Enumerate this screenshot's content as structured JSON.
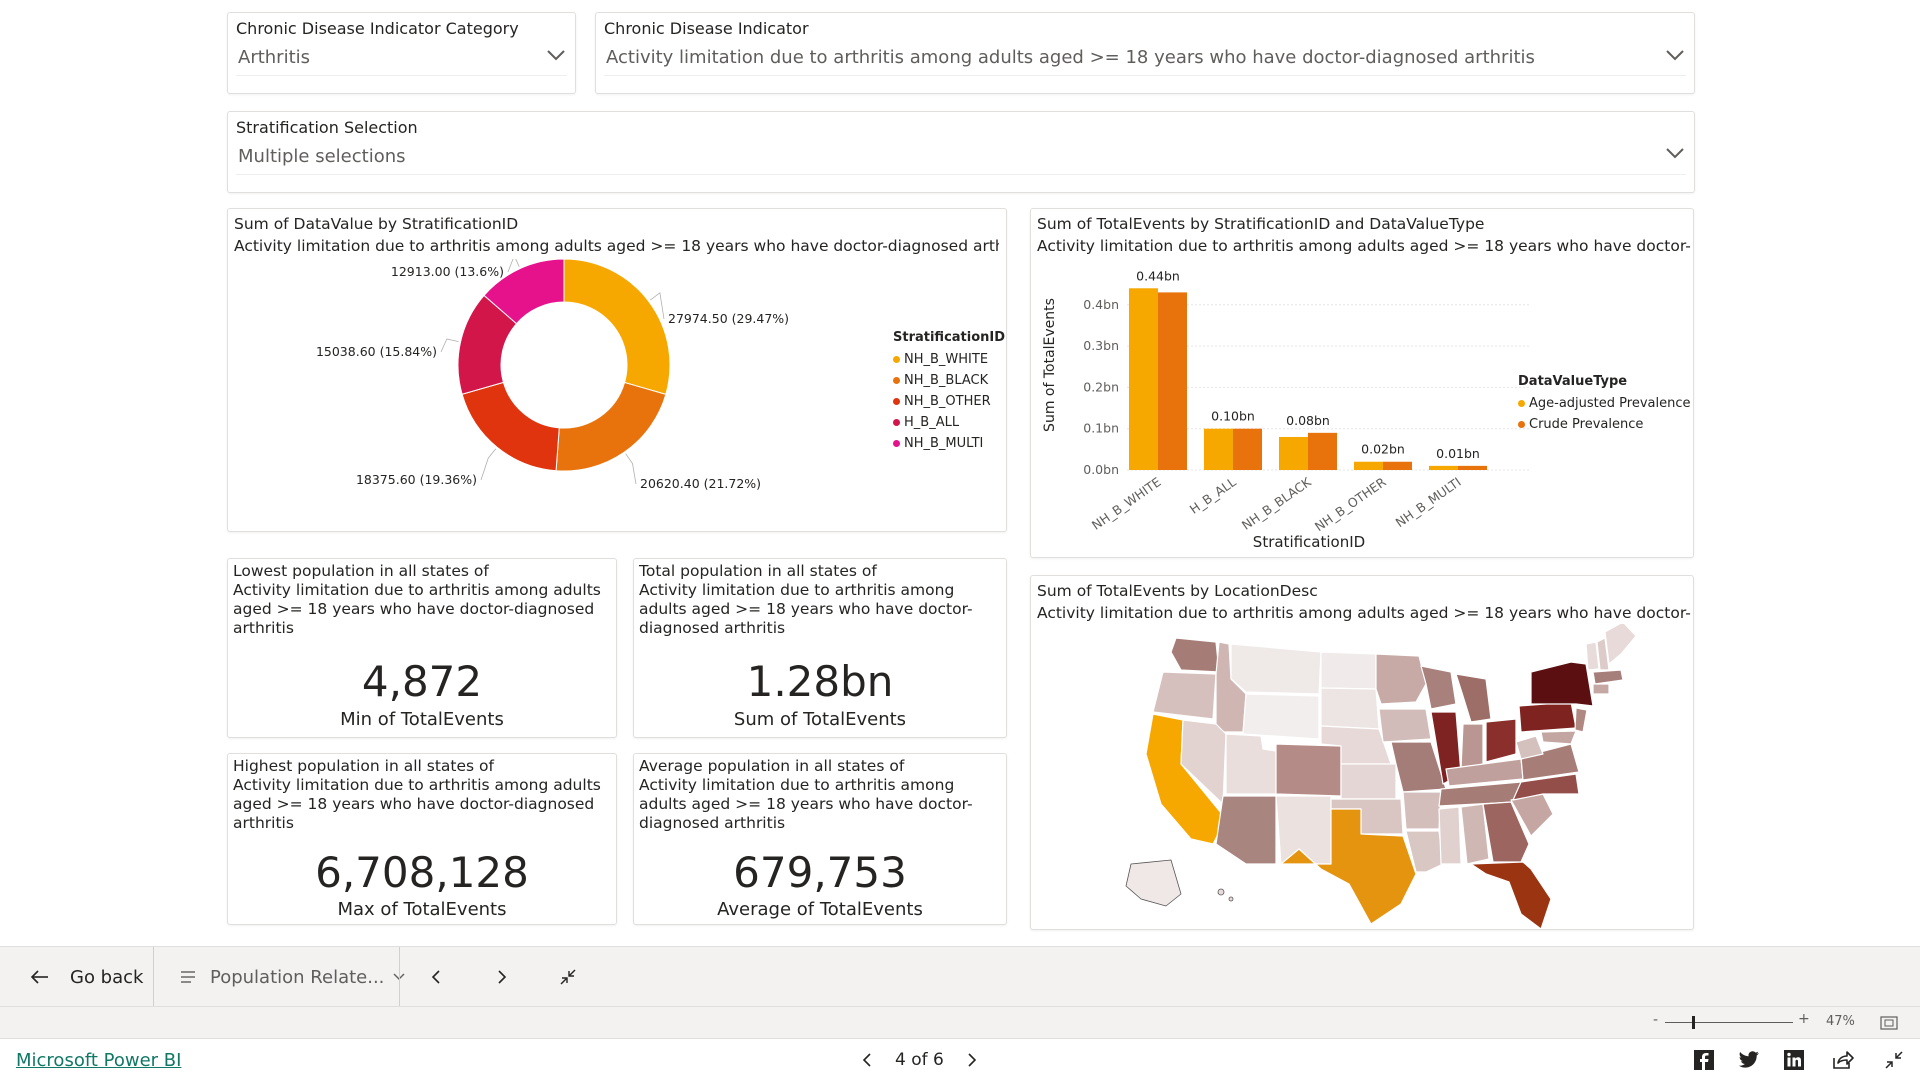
{
  "slicers": {
    "category": {
      "title": "Chronic Disease Indicator Category",
      "value": "Arthritis"
    },
    "indicator": {
      "title": "Chronic Disease Indicator",
      "value": "Activity limitation due to arthritis among adults aged >= 18 years who have doctor-diagnosed arthritis"
    },
    "stratification": {
      "title": "Stratification Selection",
      "value": "Multiple selections"
    }
  },
  "donut": {
    "title": "Sum of DataValue by StratificationID",
    "subtitle": "Activity limitation due to arthritis among adults aged >= 18 years who have doctor-diagnosed arthritis",
    "legend_title": "StratificationID",
    "labels": [
      "27974.50 (29.47%)",
      "20620.40 (21.72%)",
      "18375.60 (19.36%)",
      "15038.60 (15.84%)",
      "12913.00 (13.6%)"
    ]
  },
  "bar": {
    "title": "Sum of TotalEvents by StratificationID and DataValueType",
    "subtitle": "Activity limitation due to arthritis among adults aged >= 18 years who have doctor-dia...",
    "legend_title": "DataValueType",
    "ytick_labels": [
      "0.0bn",
      "0.1bn",
      "0.2bn",
      "0.3bn",
      "0.4bn"
    ],
    "data_labels": [
      "0.44bn",
      "0.10bn",
      "0.08bn",
      "0.02bn",
      "0.01bn"
    ]
  },
  "chart_data": [
    {
      "type": "pie",
      "title": "Sum of DataValue by StratificationID",
      "categories": [
        "NH_B_WHITE",
        "NH_B_BLACK",
        "NH_B_OTHER",
        "H_B_ALL",
        "NH_B_MULTI"
      ],
      "values": [
        27974.5,
        20620.4,
        18375.6,
        15038.6,
        12913.0
      ],
      "percent": [
        29.47,
        21.72,
        19.36,
        15.84,
        13.6
      ],
      "colors": [
        "#f7a800",
        "#e8730c",
        "#e0340f",
        "#d2164a",
        "#e6128c"
      ],
      "legend": "right"
    },
    {
      "type": "bar",
      "title": "Sum of TotalEvents by StratificationID and DataValueType",
      "xlabel": "StratificationID",
      "ylabel": "Sum of TotalEvents",
      "categories": [
        "NH_B_WHITE",
        "H_B_ALL",
        "NH_B_BLACK",
        "NH_B_OTHER",
        "NH_B_MULTI"
      ],
      "series": [
        {
          "name": "Age-adjusted Prevalence",
          "color": "#f7a800",
          "values": [
            0.44,
            0.1,
            0.08,
            0.02,
            0.01
          ]
        },
        {
          "name": "Crude Prevalence",
          "color": "#e8730c",
          "values": [
            0.43,
            0.1,
            0.09,
            0.02,
            0.01
          ]
        }
      ],
      "ylim": [
        0,
        0.45
      ],
      "unit": "bn",
      "legend": "right"
    }
  ],
  "kpis": {
    "min": {
      "title": "Lowest population in all states of",
      "subtitle": "Activity limitation due to arthritis among adults aged >= 18 years who have doctor-diagnosed arthritis",
      "value": "4,872",
      "label": "Min of TotalEvents"
    },
    "sum": {
      "title": "Total population in all states of",
      "subtitle": "Activity limitation due to arthritis among adults aged >= 18 years who have doctor-diagnosed arthritis",
      "value": "1.28bn",
      "label": "Sum of TotalEvents"
    },
    "max": {
      "title": "Highest population in all states of",
      "subtitle": "Activity limitation due to arthritis among adults aged >= 18 years who have doctor-diagnosed arthritis",
      "value": "6,708,128",
      "label": "Max of TotalEvents"
    },
    "avg": {
      "title": "Average population in all states of",
      "subtitle": "Activity limitation due to arthritis among adults aged >= 18 years who have doctor-diagnosed arthritis",
      "value": "679,753",
      "label": "Average of TotalEvents"
    }
  },
  "map": {
    "title": "Sum of TotalEvents by LocationDesc",
    "subtitle": "Activity limitation due to arthritis among adults aged >= 18 years who have doctor-dia..."
  },
  "bottombar": {
    "back_label": "Go back",
    "pages_label": "Population Relate..."
  },
  "zoom": {
    "value": "47%",
    "level": 0.47
  },
  "footer": {
    "brand": "Microsoft Power BI",
    "page_indicator": "4 of 6"
  },
  "icons": [
    "arrow-left-icon",
    "pages-list-icon",
    "chevron-down-icon",
    "chevron-left-icon",
    "chevron-right-icon",
    "collapse-icon",
    "fit-to-page-icon",
    "facebook-icon",
    "twitter-icon",
    "linkedin-icon",
    "share-icon",
    "fullscreen-icon"
  ]
}
